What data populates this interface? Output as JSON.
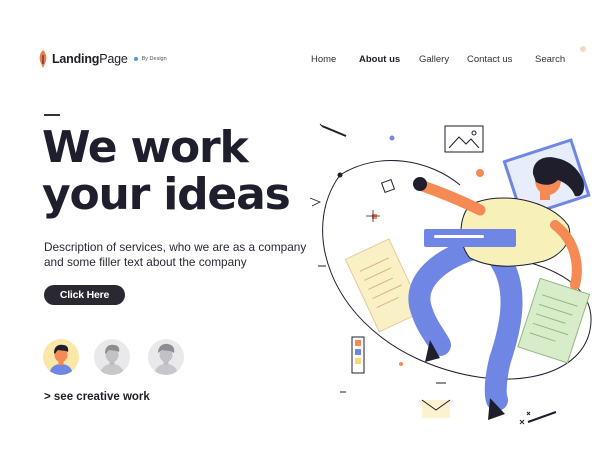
{
  "brand": {
    "name_bold": "Landing",
    "name_regular": "Page",
    "tagline": "By Design",
    "accent": "#f07b4c",
    "dot_color": "#4e9ad6"
  },
  "nav": {
    "items": [
      "Home",
      "About us",
      "Gallery",
      "Contact us",
      "Search"
    ],
    "active": "About us"
  },
  "hero": {
    "headline_line1": "We work",
    "headline_line2": "your ideas",
    "description_line1": "Description of services, who we are as a company",
    "description_line2": "and some filler text about the company",
    "cta_label": "Click Here",
    "see_more": "> see creative work"
  },
  "avatars": [
    {
      "name": "avatar-colored",
      "style": "color"
    },
    {
      "name": "avatar-gray-1",
      "style": "grayscale"
    },
    {
      "name": "avatar-gray-2",
      "style": "grayscale"
    }
  ],
  "colors": {
    "text_dark": "#1f1e2c",
    "button_bg": "#2a2830",
    "illustration_blue": "#6f86e5",
    "illustration_orange": "#f58a55",
    "illustration_yellow": "#f7f0b9",
    "illustration_green": "#cfe6c2",
    "illustration_navy": "#1f1e2c"
  },
  "illustration": {
    "icon": "person-flying-with-papers-illustration"
  }
}
